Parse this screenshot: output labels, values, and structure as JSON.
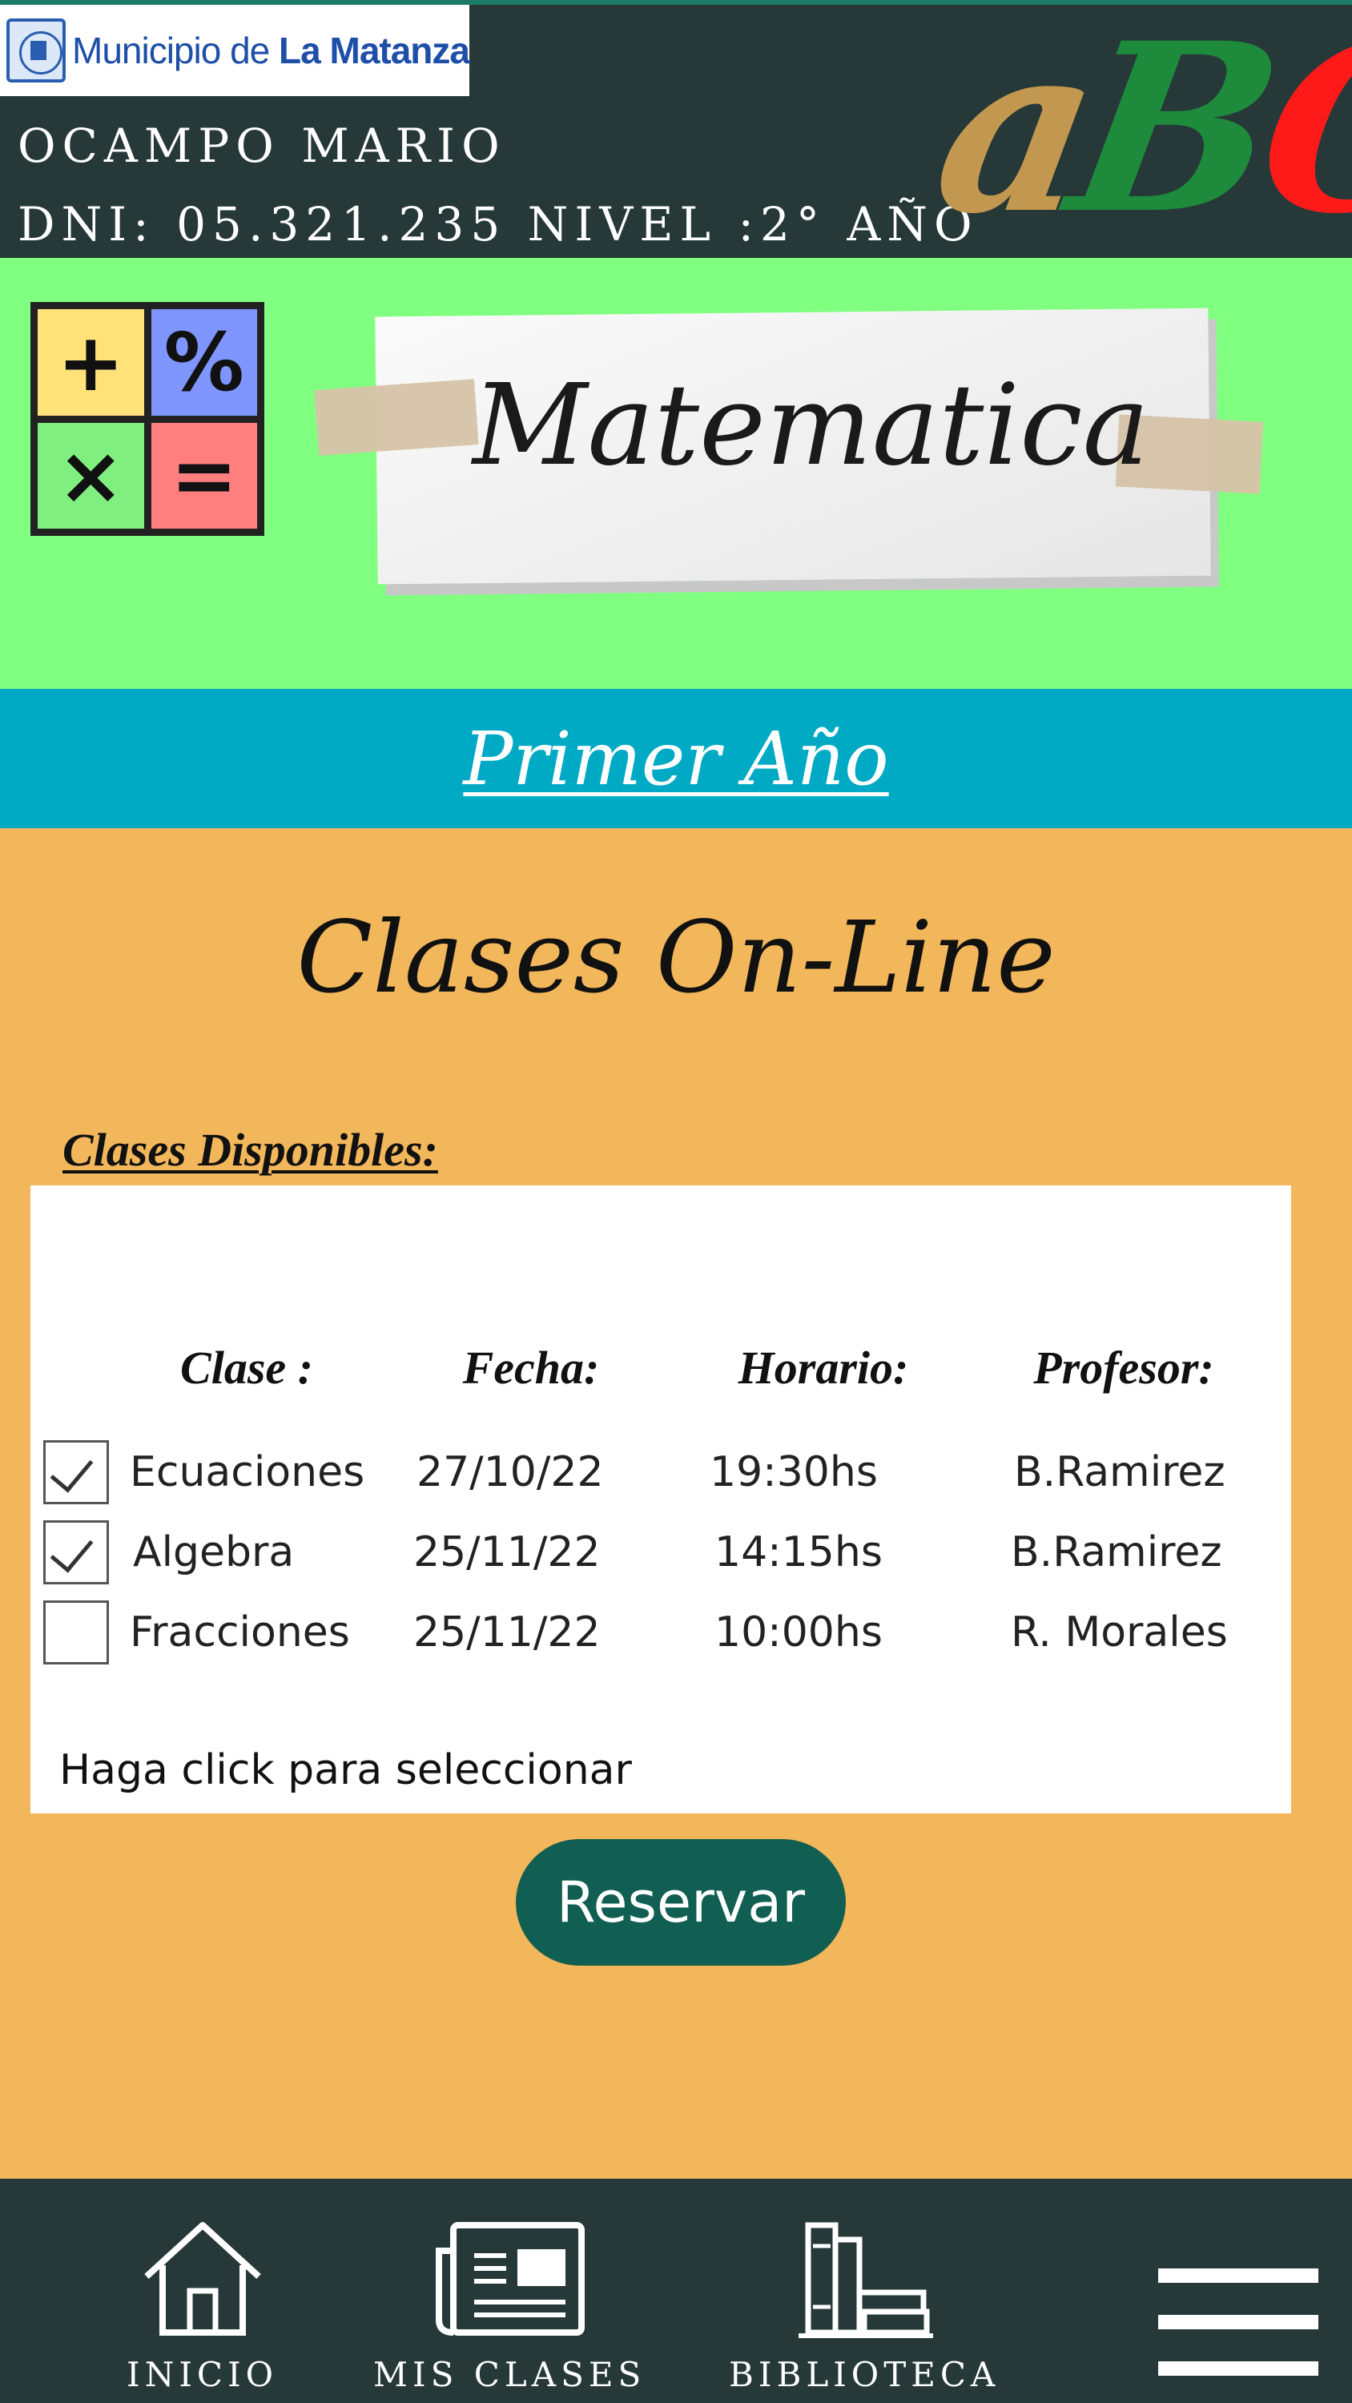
{
  "header": {
    "logo_text_prefix": "Municipio de ",
    "logo_text_bold": "La Matanza",
    "user_name": "OCAMPO MARIO",
    "user_dni_line": "DNI: 05.321.235 NIVEL :2° AÑO",
    "brand_letters": [
      "a",
      "B",
      "C"
    ]
  },
  "subject": {
    "title": "Matematica",
    "calculator_keys": [
      "+",
      "%",
      "×",
      "="
    ]
  },
  "year": {
    "label": "Primer Año"
  },
  "main": {
    "title": "Clases On-Line",
    "section_title": "Clases Disponibles:",
    "columns": [
      "Clase :",
      "Fecha:",
      "Horario:",
      "Profesor:"
    ],
    "rows": [
      {
        "clase": "Ecuaciones",
        "fecha": "27/10/22",
        "horario": "19:30hs",
        "profesor": "B.Ramirez",
        "checked": true
      },
      {
        "clase": "Algebra",
        "fecha": "25/11/22",
        "horario": "14:15hs",
        "profesor": "B.Ramirez",
        "checked": true
      },
      {
        "clase": "Fracciones",
        "fecha": "25/11/22",
        "horario": "10:00hs",
        "profesor": "R. Morales",
        "checked": false
      }
    ],
    "hint": "Haga click para seleccionar",
    "reserve_button": "Reservar"
  },
  "nav": {
    "items": [
      {
        "label": "INICIO",
        "icon": "home-icon"
      },
      {
        "label": "MIS CLASES",
        "icon": "newspaper-icon"
      },
      {
        "label": "BIBLIOTECA",
        "icon": "books-icon"
      }
    ],
    "menu_icon": "hamburger-menu-icon"
  },
  "colors": {
    "header_bg": "#263838",
    "subject_bg": "#80ff80",
    "year_bar_bg": "#00a9c4",
    "main_bg": "#f2b65b",
    "button_bg": "#115e52",
    "brand_a": "#c2974f",
    "brand_b": "#1d8a3c",
    "brand_c": "#ff1a1a"
  }
}
